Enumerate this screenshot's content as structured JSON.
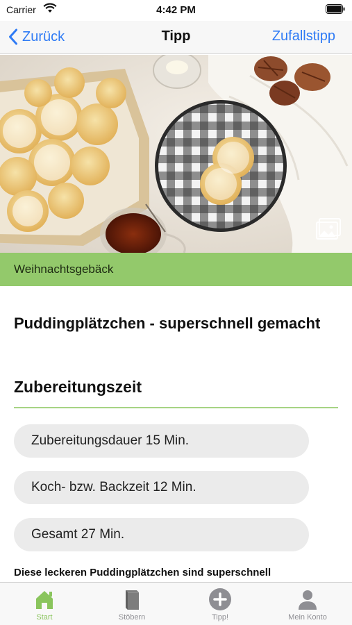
{
  "status_bar": {
    "carrier": "Carrier",
    "time": "4:42 PM",
    "icons": [
      "wifi-icon",
      "battery-icon"
    ]
  },
  "nav": {
    "back_label": "Zurück",
    "title": "Tipp",
    "random_label": "Zufallstipp",
    "accent_color": "#2f7bf5"
  },
  "hero": {
    "icons": [
      "gallery-icon"
    ]
  },
  "category": {
    "label": "Weihnachtsgebäck",
    "color": "#93c96b"
  },
  "recipe": {
    "title": "Puddingplätzchen - superschnell gemacht",
    "section_heading": "Zubereitungszeit",
    "times": [
      "Zubereitungsdauer 15 Min.",
      "Koch- bzw. Backzeit 12 Min.",
      "Gesamt 27 Min."
    ],
    "description": "Diese leckeren Puddingplätzchen sind superschnell"
  },
  "tab_bar": {
    "items": [
      {
        "label": "Start",
        "icon": "home-icon",
        "active": true
      },
      {
        "label": "Stöbern",
        "icon": "book-icon",
        "active": false
      },
      {
        "label": "Tipp!",
        "icon": "plus-circle-icon",
        "active": false
      },
      {
        "label": "Mein Konto",
        "icon": "person-icon",
        "active": false
      }
    ],
    "active_color": "#8ac55d",
    "inactive_color": "#8e8e93"
  }
}
